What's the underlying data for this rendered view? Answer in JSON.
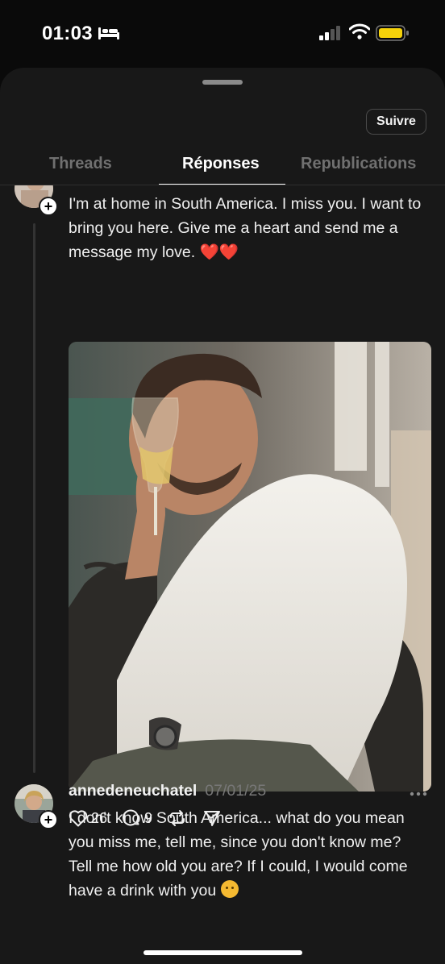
{
  "status_bar": {
    "time": "01:03"
  },
  "header": {
    "follow_label": "Suivre"
  },
  "tabs": [
    {
      "label": "Threads",
      "active": false
    },
    {
      "label": "Réponses",
      "active": true
    },
    {
      "label": "Republications",
      "active": false
    }
  ],
  "posts": [
    {
      "text": "I'm at home in South America. I miss you. I want to bring you here. Give me a heart and send me a message my love.",
      "emoji_suffix": "❤️❤️",
      "has_image": true,
      "likes": "26",
      "replies": "9"
    },
    {
      "author": "annedeneuchatel",
      "date": "07/01/25",
      "text": "I don't know South America... what do you mean you miss me, tell me, since you don't know me? Tell me how old you are? If I could, I would come have a drink with you",
      "emoji_suffix": "🤗"
    }
  ],
  "icons": {
    "like": "heart-icon",
    "reply": "comment-icon",
    "repost": "repost-icon",
    "share": "send-icon",
    "more": "more-icon"
  },
  "colors": {
    "background": "#181818",
    "status_background": "#0a0a0a",
    "text": "#f0f0f0",
    "muted": "#777777",
    "battery": "#f5d20a"
  }
}
